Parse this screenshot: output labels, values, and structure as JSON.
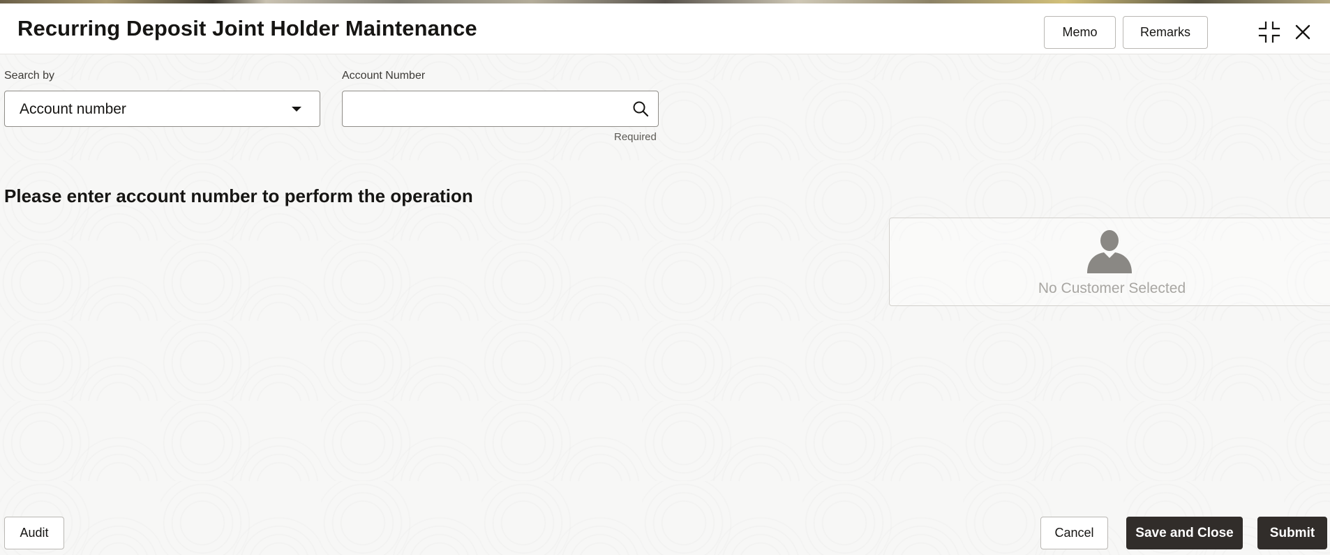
{
  "header": {
    "title": "Recurring Deposit Joint Holder Maintenance",
    "memo_label": "Memo",
    "remarks_label": "Remarks",
    "compress_icon": "compress-icon",
    "close_icon": "close-icon"
  },
  "search": {
    "search_by_label": "Search by",
    "search_by_value": "Account number",
    "account_number_label": "Account Number",
    "account_number_value": "",
    "account_number_placeholder": "",
    "required_text": "Required",
    "search_icon": "search-icon"
  },
  "main": {
    "prompt": "Please enter account number to perform the operation"
  },
  "customer_card": {
    "avatar_icon": "user-icon",
    "text": "No Customer Selected"
  },
  "footer": {
    "audit_label": "Audit",
    "cancel_label": "Cancel",
    "save_close_label": "Save and Close",
    "submit_label": "Submit"
  },
  "colors": {
    "primary_dark": "#312d2a",
    "text": "#161513",
    "muted": "#a8a6a2"
  }
}
